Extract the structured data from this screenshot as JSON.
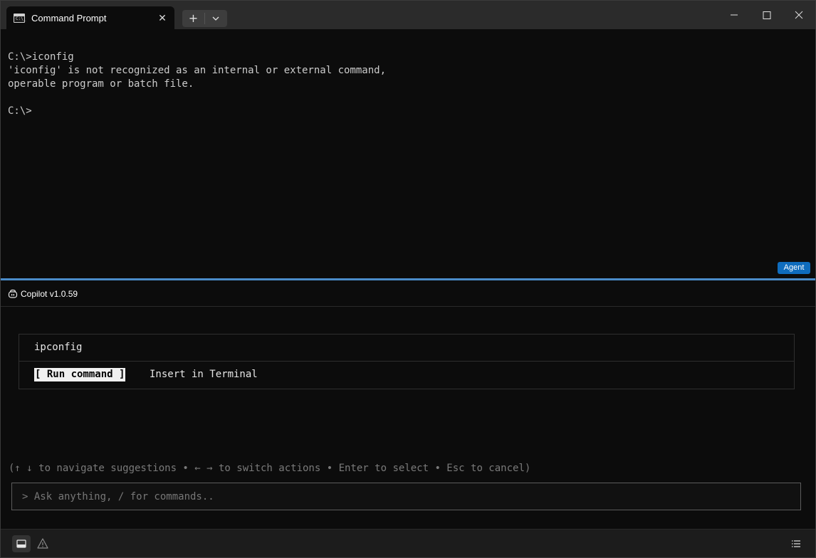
{
  "window": {
    "tab_title": "Command Prompt",
    "tab_icon": "cmd-icon",
    "tab_icon_text": "C:\\_",
    "new_tab_label": "+",
    "controls": [
      "minimize-icon",
      "maximize-icon",
      "close-icon"
    ]
  },
  "terminal": {
    "lines": [
      "C:\\>iconfig",
      "'iconfig' is not recognized as an internal or external command,",
      "operable program or batch file.",
      "",
      "C:\\>"
    ],
    "agent_badge": "Agent"
  },
  "copilot": {
    "title": "Copilot v1.0.59",
    "suggestion": "ipconfig",
    "run_label": "[ Run command ]",
    "insert_label": "Insert in Terminal",
    "hint": "(↑ ↓ to navigate suggestions • ← → to switch actions • Enter to select • Esc to cancel)",
    "prompt_prefix": ">",
    "placeholder": "Ask anything, / for commands.."
  },
  "statusbar": {
    "left_icons": [
      "panel-icon",
      "warning-icon"
    ],
    "right_icon": "list-icon"
  },
  "colors": {
    "background": "#0c0c0c",
    "titlebar": "#2b2b2b",
    "accent": "#0f6cbd",
    "divider": "#4a8cc9"
  }
}
